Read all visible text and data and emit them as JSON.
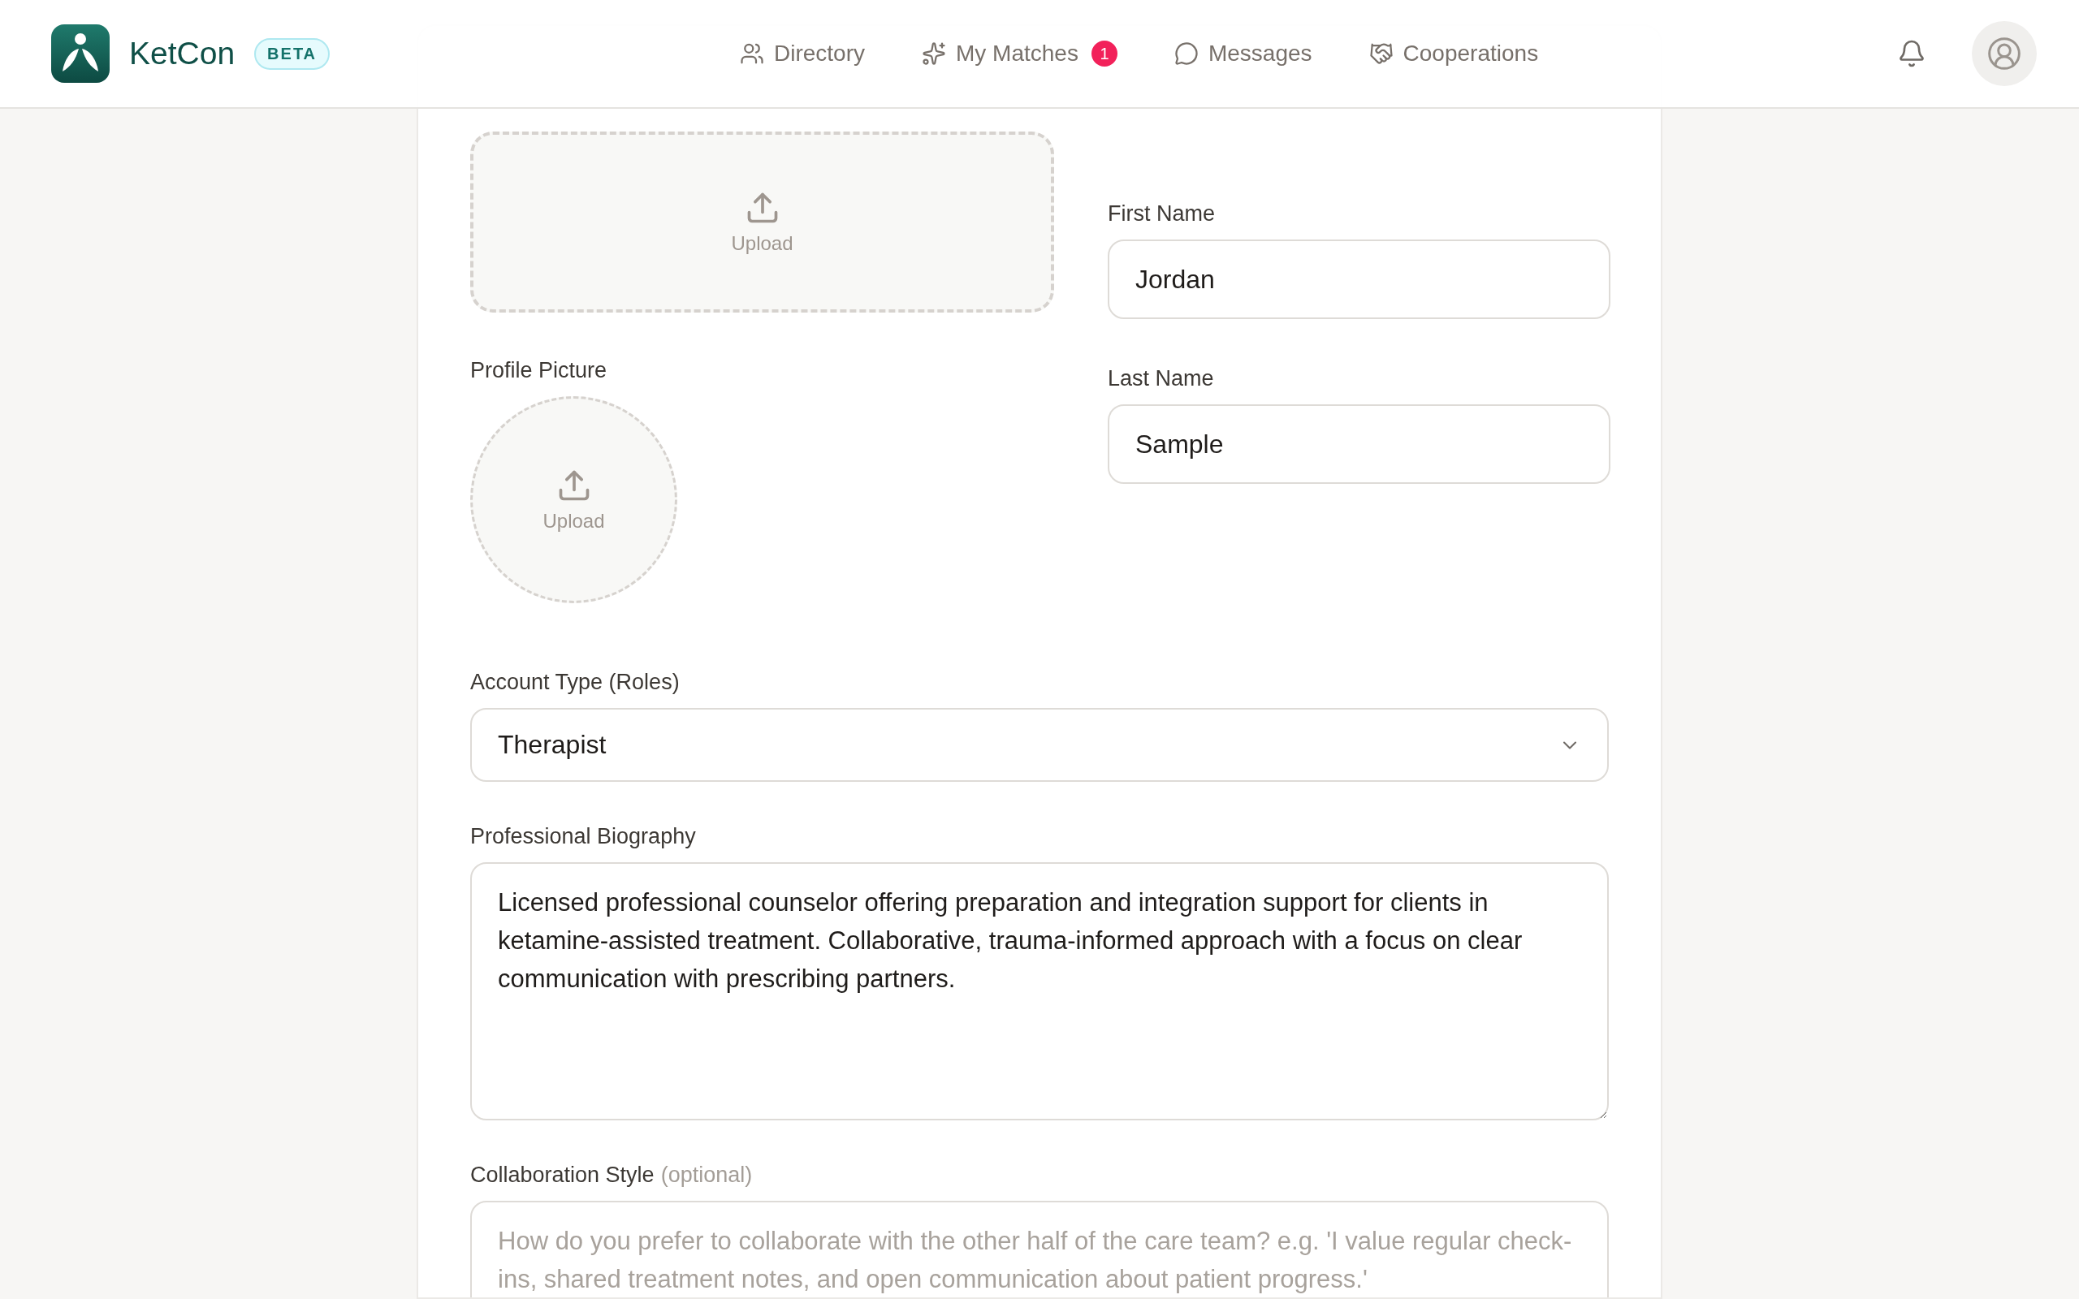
{
  "header": {
    "brand": "KetCon",
    "badge": "BETA",
    "nav": [
      {
        "label": "Directory"
      },
      {
        "label": "My Matches",
        "count": "1"
      },
      {
        "label": "Messages"
      },
      {
        "label": "Cooperations"
      }
    ]
  },
  "form": {
    "banner": {
      "action": "Upload"
    },
    "first_name": {
      "label": "First Name",
      "value": "Jordan"
    },
    "profile_picture": {
      "label": "Profile Picture",
      "action": "Upload"
    },
    "last_name": {
      "label": "Last Name",
      "value": "Sample"
    },
    "account_type": {
      "label": "Account Type (Roles)",
      "value": "Therapist"
    },
    "biography": {
      "label": "Professional Biography",
      "value": "Licensed professional counselor offering preparation and integration support for clients in ketamine-assisted treatment. Collaborative, trauma-informed approach with a focus on clear communication with prescribing partners."
    },
    "collaboration_style": {
      "label": "Collaboration Style",
      "hint": "(optional)",
      "placeholder": "How do you prefer to collaborate with the other half of the care team? e.g. 'I value regular check-ins, shared treatment notes, and open communication about patient progress.'"
    }
  }
}
